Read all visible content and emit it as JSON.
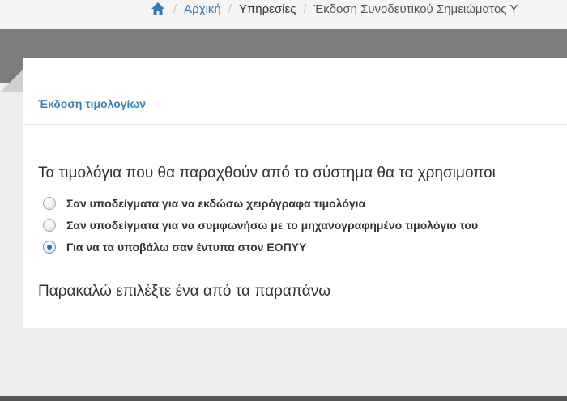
{
  "breadcrumb": {
    "home_icon": "home-icon",
    "separator": "/",
    "home": "Αρχική",
    "services": "Υπηρεσίες",
    "current": "Έκδοση Συνοδευτικού Σημειώματος Υ"
  },
  "panel": {
    "title": "Έκδοση τιμολογίων",
    "question": "Τα τιμολόγια που θα παραχθούν από το σύστημα θα τα χρησιμοποι",
    "options": [
      {
        "label": "Σαν υποδείγματα για να εκδώσω χειρόγραφα τιμολόγια",
        "checked": false
      },
      {
        "label": "Σαν υποδείγματα για να συμφωνήσω με το μηχανογραφημένο τιμολόγιο του",
        "checked": false
      },
      {
        "label": "Για να τα υποβάλω σαν έντυπα στον ΕΟΠΥΥ",
        "checked": true
      }
    ],
    "hint": "Παρακαλώ επιλέξτε ένα από τα παραπάνω"
  },
  "colors": {
    "link": "#337ab7",
    "title": "#3a7fc1",
    "band": "#7d7d7d"
  }
}
